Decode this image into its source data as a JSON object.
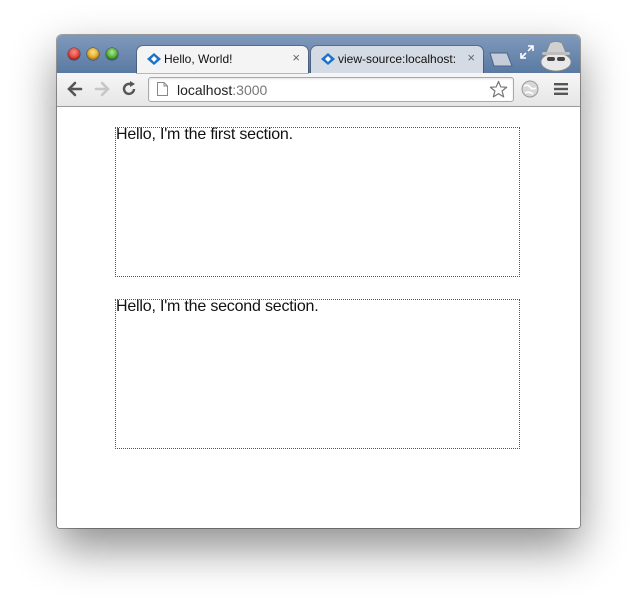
{
  "tabs": [
    {
      "title": "Hello, World!",
      "close": "×",
      "active": true
    },
    {
      "title": "view-source:localhost:",
      "close": "×",
      "active": false
    }
  ],
  "address_bar": {
    "host": "localhost",
    "port": ":3000"
  },
  "icons": {
    "back": "back-arrow-icon",
    "forward": "forward-arrow-icon",
    "reload": "reload-icon",
    "page": "page-icon",
    "bookmark": "star-icon",
    "extension": "globe-icon",
    "menu": "menu-icon",
    "incognito": "incognito-icon",
    "fullscreen": "fullscreen-icon"
  },
  "page": {
    "sections": [
      {
        "text": "Hello, I'm the first section."
      },
      {
        "text": "Hello, I'm the second section."
      }
    ]
  },
  "colors": {
    "titlebar": "#6a88b0",
    "favicon": "#1a73c8"
  }
}
